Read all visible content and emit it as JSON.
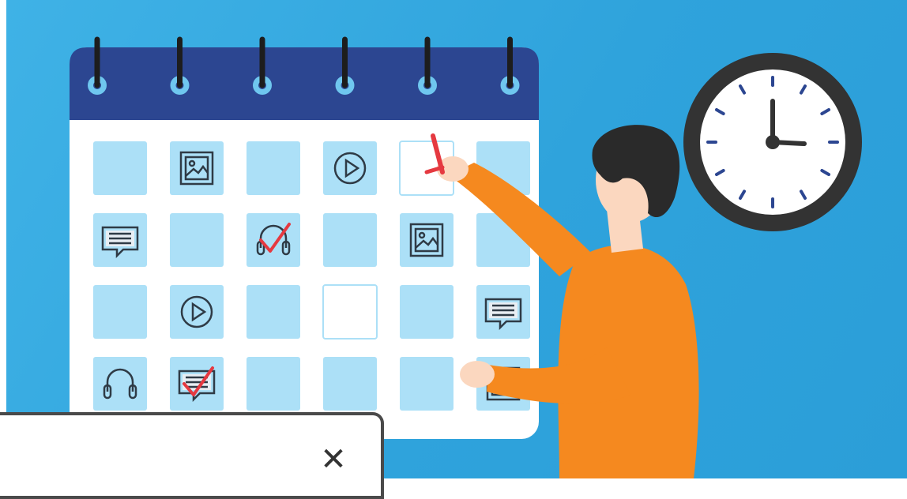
{
  "illustration": {
    "colors": {
      "background": "#35a9e0",
      "calendar_header": "#2c4691",
      "calendar_body": "#ffffff",
      "cell": "#ace0f7",
      "icon_stroke": "#2f3b46",
      "check_mark": "#e53940",
      "shirt": "#f5891f",
      "hair": "#2a2a2a",
      "skin": "#fbd7bf",
      "clock_rim": "#333333",
      "clock_ticks": "#2c4691"
    },
    "calendar_grid": [
      [
        "empty",
        "image-icon",
        "empty",
        "play-icon",
        "empty-highlight",
        "empty"
      ],
      [
        "chat-icon",
        "empty",
        "headphones-check-icon",
        "empty",
        "image-icon",
        "empty"
      ],
      [
        "empty",
        "play-icon",
        "empty",
        "empty-highlight",
        "empty",
        "chat-icon"
      ],
      [
        "headphones-icon",
        "chat-check-icon",
        "empty",
        "empty",
        "empty",
        "image-icon"
      ]
    ]
  },
  "popup": {
    "close_icon": "close-icon",
    "close_glyph": "✕"
  }
}
